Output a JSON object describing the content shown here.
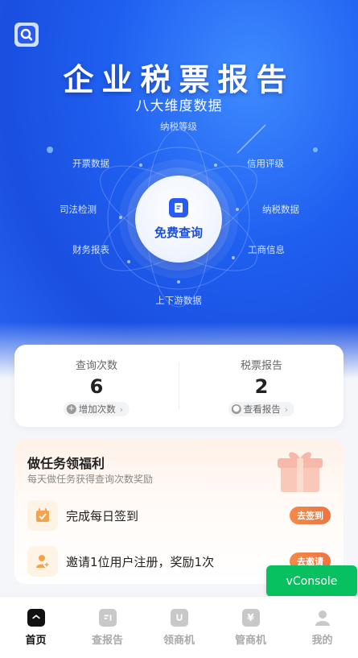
{
  "hero": {
    "title": "企业税票报告",
    "subtitle": "八大维度数据",
    "dimensions": [
      "纳税等级",
      "开票数据",
      "信用评级",
      "司法检测",
      "纳税数据",
      "财务报表",
      "工商信息",
      "上下游数据"
    ],
    "center_button": "免费查询"
  },
  "stats": {
    "query_count": {
      "title": "查询次数",
      "value": "6",
      "action": "增加次数"
    },
    "reports": {
      "title": "税票报告",
      "value": "2",
      "action": "查看报告"
    }
  },
  "tasks": {
    "title": "做任务领福利",
    "subtitle": "每天做任务获得查询次数奖励",
    "items": [
      {
        "label": "完成每日签到",
        "action": "去签到"
      },
      {
        "label": "邀请1位用户注册，奖励1次",
        "action": "去邀请"
      }
    ]
  },
  "vconsole": "vConsole",
  "tabbar": [
    {
      "label": "首页",
      "icon": "home-icon",
      "active": true
    },
    {
      "label": "查报告",
      "icon": "report-icon",
      "active": false
    },
    {
      "label": "领商机",
      "icon": "opportunity-icon",
      "active": false
    },
    {
      "label": "管商机",
      "icon": "manage-icon",
      "active": false
    },
    {
      "label": "我的",
      "icon": "user-icon",
      "active": false
    }
  ],
  "colors": {
    "primary": "#1f5ff0",
    "accent": "#ee7440",
    "vconsole": "#07c160"
  }
}
